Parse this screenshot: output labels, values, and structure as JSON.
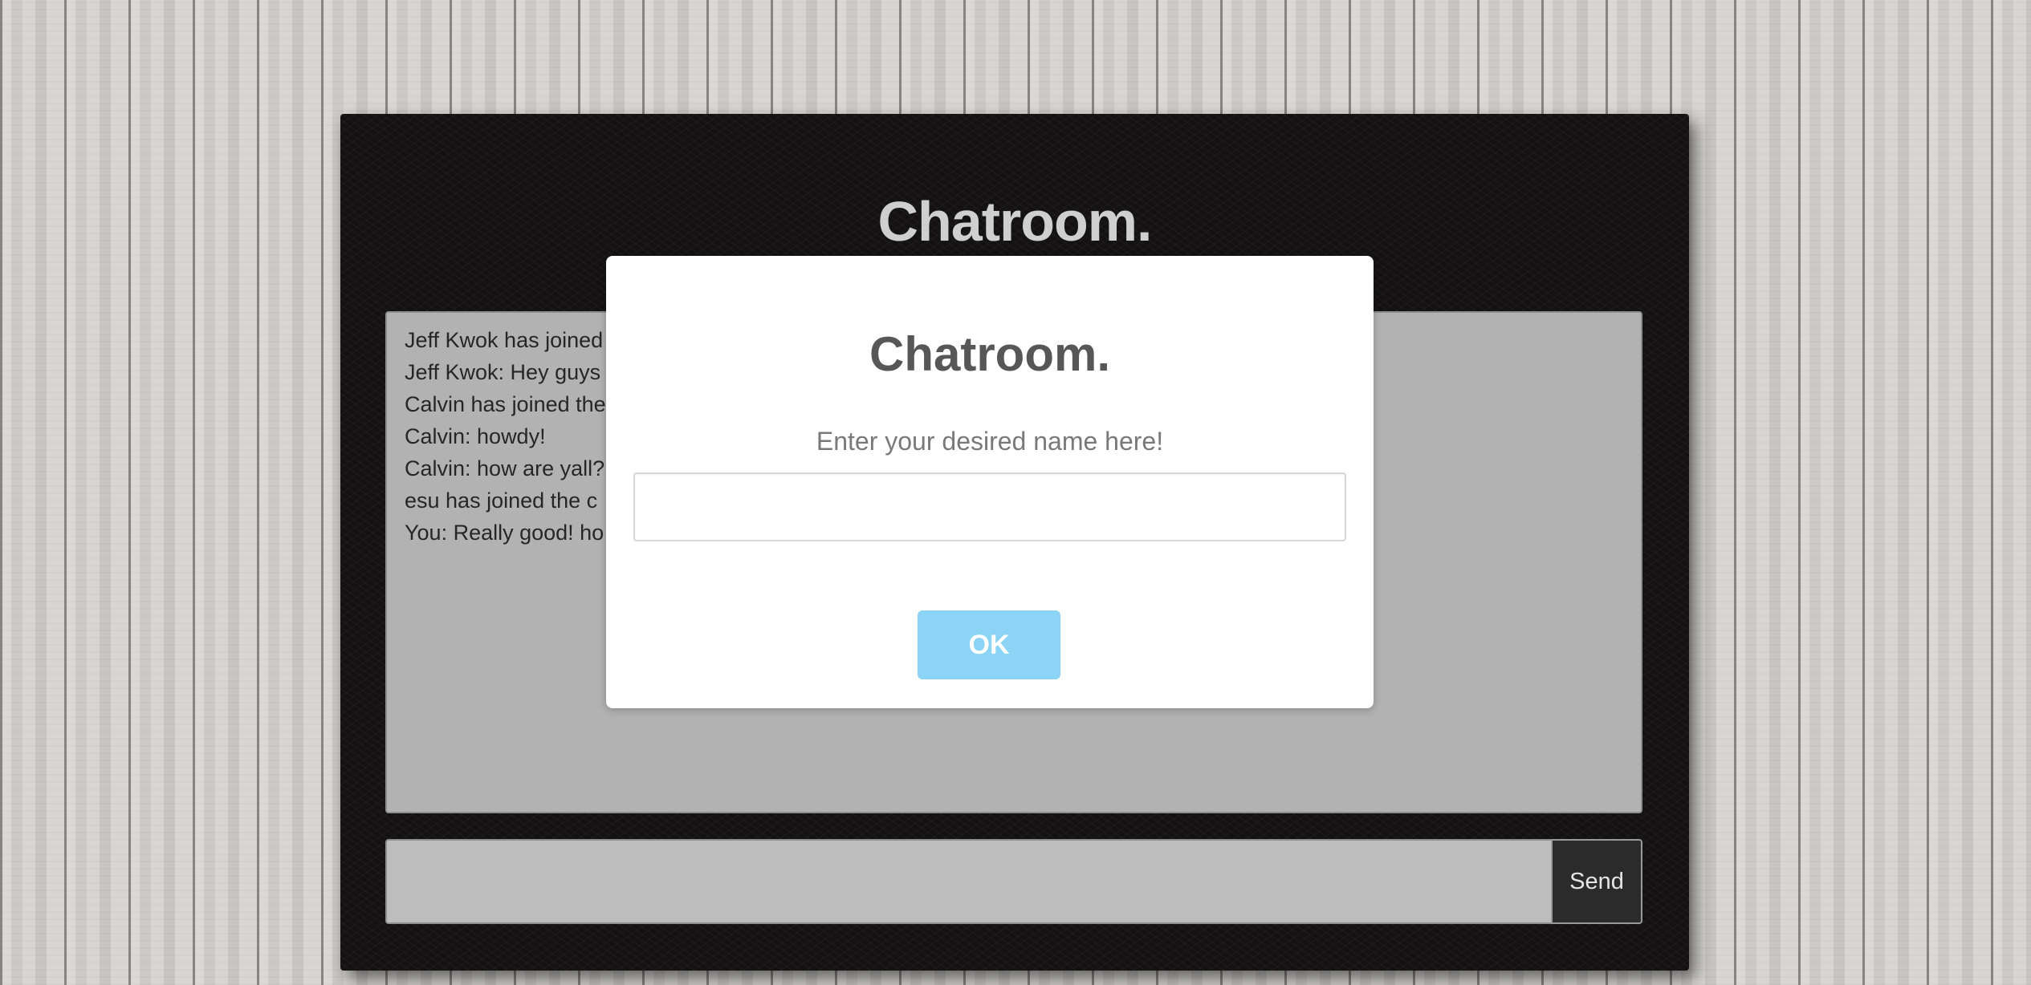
{
  "colors": {
    "panel_background": "#131111",
    "messages_background": "#b2b2b2",
    "ok_button": "#8cd4f5",
    "send_button": "#2a2b2a"
  },
  "chat": {
    "title": "Chatroom.",
    "messages": [
      "Jeff Kwok has joined",
      "Jeff Kwok: Hey guys",
      "Calvin has joined the",
      "Calvin: howdy!",
      "Calvin: how are yall?",
      "esu has joined the c",
      "You: Really good! ho"
    ],
    "input_value": "",
    "send_label": "Send"
  },
  "modal": {
    "title": "Chatroom.",
    "text": "Enter your desired name here!",
    "input_value": "",
    "ok_label": "OK"
  }
}
